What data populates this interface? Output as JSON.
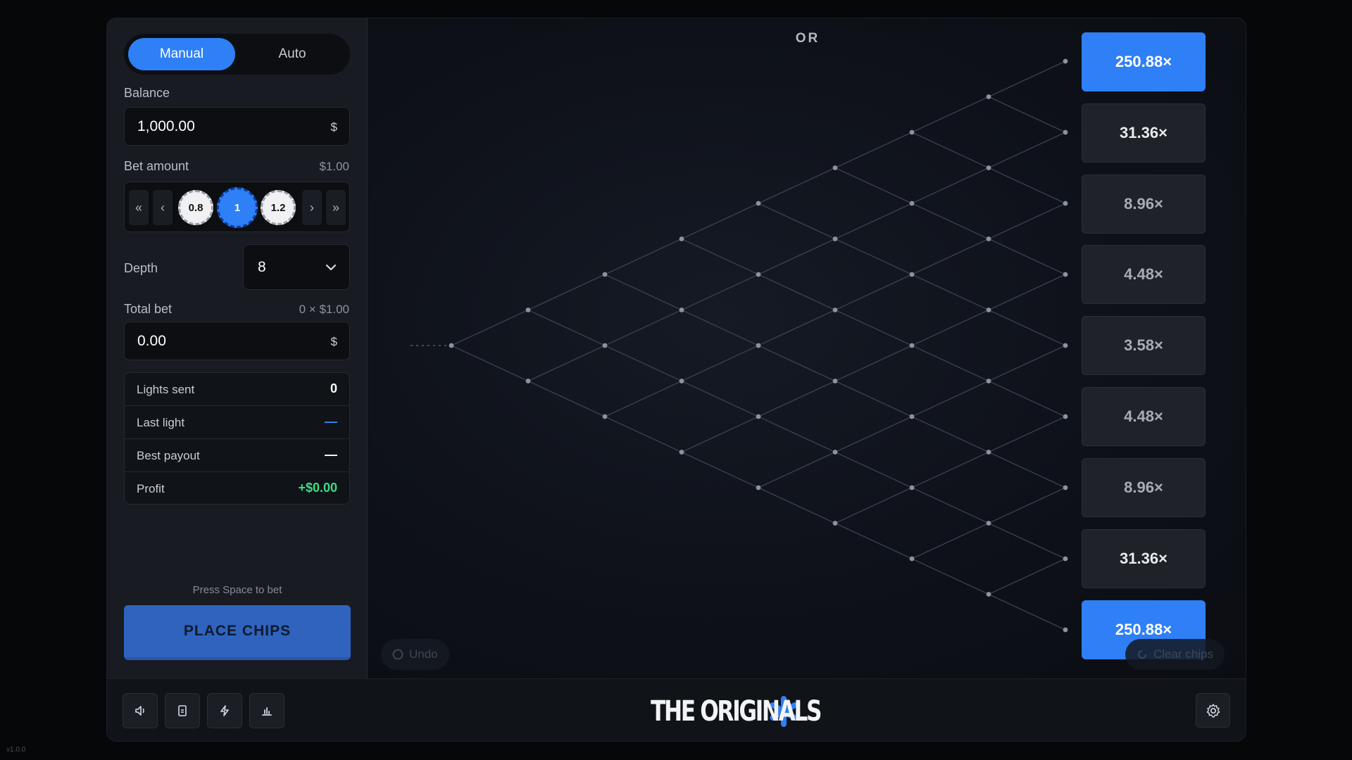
{
  "mode_tabs": [
    {
      "label": "Manual",
      "active": true
    },
    {
      "label": "Auto",
      "active": false
    }
  ],
  "balance": {
    "label": "Balance",
    "value": "1,000.00",
    "currency": "$"
  },
  "bet_amount": {
    "label": "Bet amount",
    "display": "$1.00",
    "chips": [
      "0.8",
      "1",
      "1.2"
    ],
    "selected_chip": "1",
    "arrows": {
      "first": "«",
      "prev": "‹",
      "next": "›",
      "last": "»"
    }
  },
  "depth": {
    "label": "Depth",
    "value": "8"
  },
  "total_bet": {
    "label": "Total bet",
    "formula": "0 × $1.00",
    "value": "0.00",
    "currency": "$"
  },
  "stats": [
    {
      "key": "Lights sent",
      "value": "0"
    },
    {
      "key": "Last light",
      "value": "—"
    },
    {
      "key": "Best payout",
      "value": "—"
    },
    {
      "key": "Profit",
      "value": "+$0.00"
    }
  ],
  "colors": {
    "accent": "#2f7ff6",
    "profit": "#3ddc84",
    "last_light": "#3b82f6"
  },
  "hint": "Press Space to bet",
  "place_button": "PLACE CHIPS",
  "board": {
    "title": "OR",
    "multipliers": [
      "250.88×",
      "31.36×",
      "8.96×",
      "4.48×",
      "3.58×",
      "4.48×",
      "8.96×",
      "31.36×",
      "250.88×"
    ],
    "undo_label": "Undo",
    "clear_label": "Clear chips"
  },
  "toolbar": {
    "icons": [
      "speaker-icon",
      "document-icon",
      "lightning-icon",
      "bar-chart-icon"
    ],
    "settings_icon": "gear-icon"
  },
  "brand": {
    "text": "THE ORIGINALS"
  },
  "version": "v1.0.0"
}
